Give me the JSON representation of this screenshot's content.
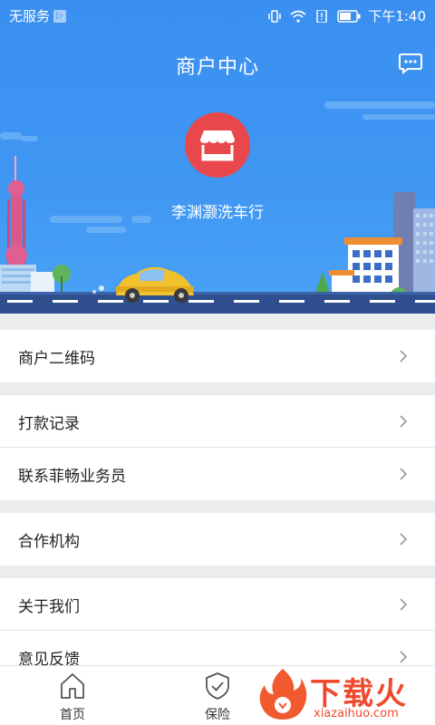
{
  "status_bar": {
    "carrier": "无服务",
    "carrier_badge": "▷",
    "time": "下午1:40"
  },
  "header": {
    "title": "商户中心",
    "chat_icon": "chat-bubble-icon"
  },
  "merchant": {
    "icon": "storefront-icon",
    "name": "李渊灏洗车行"
  },
  "menu": {
    "items": [
      {
        "label": "商户二维码"
      },
      {
        "label": "打款记录"
      },
      {
        "label": "联系菲畅业务员"
      },
      {
        "label": "合作机构"
      },
      {
        "label": "关于我们"
      },
      {
        "label": "意见反馈"
      }
    ]
  },
  "tabbar": {
    "tabs": [
      {
        "label": "首页",
        "icon": "home-icon"
      },
      {
        "label": "保险",
        "icon": "shield-check-icon"
      }
    ]
  },
  "watermark": {
    "text": "下载火",
    "sub": "xiazaihuo.com"
  },
  "colors": {
    "hero_blue": "#3f97f3",
    "shop_red": "#e8484c",
    "watermark_red": "#f04a2e"
  }
}
